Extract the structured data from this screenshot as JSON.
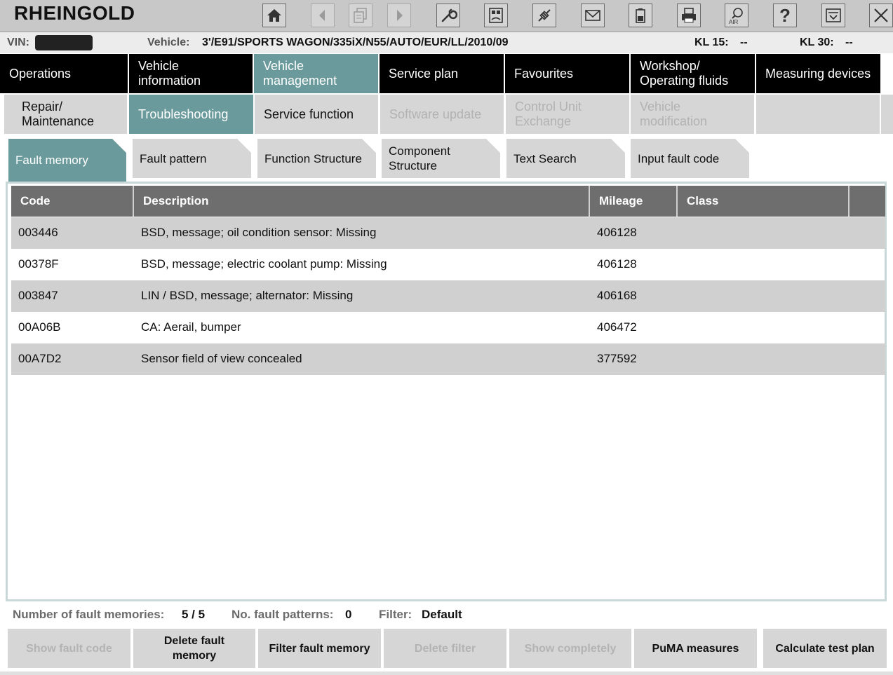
{
  "app": {
    "title": "RHEINGOLD"
  },
  "toolbar": {
    "buttons": [
      {
        "icon": "home-icon",
        "enabled": true
      },
      {
        "icon": "back-arrow-icon",
        "enabled": false
      },
      {
        "icon": "documents-icon",
        "enabled": false
      },
      {
        "icon": "forward-arrow-icon",
        "enabled": false
      },
      {
        "icon": "wrench-icon",
        "enabled": true
      },
      {
        "icon": "calculator-icon",
        "enabled": true
      },
      {
        "icon": "connection-icon",
        "enabled": true
      },
      {
        "icon": "mail-icon",
        "enabled": true
      },
      {
        "icon": "battery-icon",
        "enabled": true
      },
      {
        "icon": "print-icon",
        "enabled": true
      },
      {
        "icon": "air-search-icon",
        "enabled": true,
        "text": "AIR"
      },
      {
        "icon": "help-icon",
        "enabled": true,
        "text": "?"
      },
      {
        "icon": "minimize-icon",
        "enabled": true
      },
      {
        "icon": "close-icon",
        "enabled": true
      }
    ]
  },
  "vehicle_line": {
    "vin_label": "VIN:",
    "vehicle_label": "Vehicle:",
    "vehicle_value": "3'/E91/SPORTS WAGON/335iX/N55/AUTO/EUR/LL/2010/09",
    "kl15_label": "KL 15:",
    "kl15_value": "--",
    "kl30_label": "KL 30:",
    "kl30_value": "--"
  },
  "main_nav": [
    {
      "label": "Operations",
      "active": false
    },
    {
      "label": "Vehicle information",
      "active": false
    },
    {
      "label": "Vehicle management",
      "active": true
    },
    {
      "label": "Service plan",
      "active": false
    },
    {
      "label": "Favourites",
      "active": false
    },
    {
      "label": "Workshop/ Operating fluids",
      "active": false
    },
    {
      "label": "Measuring devices",
      "active": false
    }
  ],
  "sub_nav": [
    {
      "label": "Repair/ Maintenance",
      "state": "normal"
    },
    {
      "label": "Troubleshooting",
      "state": "active"
    },
    {
      "label": "Service function",
      "state": "normal"
    },
    {
      "label": "Software update",
      "state": "disabled"
    },
    {
      "label": "Control Unit Exchange",
      "state": "disabled"
    },
    {
      "label": "Vehicle modification",
      "state": "disabled"
    },
    {
      "label": "",
      "state": "normal"
    }
  ],
  "tabs": [
    {
      "label": "Fault memory",
      "active": true
    },
    {
      "label": "Fault pattern",
      "active": false
    },
    {
      "label": "Function Structure",
      "active": false
    },
    {
      "label": "Component Structure",
      "active": false
    },
    {
      "label": "Text Search",
      "active": false
    },
    {
      "label": "Input fault code",
      "active": false
    }
  ],
  "table": {
    "columns": [
      "Code",
      "Description",
      "Mileage",
      "Class"
    ],
    "rows": [
      {
        "code": "003446",
        "description": "BSD, message; oil condition sensor: Missing",
        "mileage": "406128",
        "class": ""
      },
      {
        "code": "00378F",
        "description": "BSD, message; electric coolant pump: Missing",
        "mileage": "406128",
        "class": ""
      },
      {
        "code": "003847",
        "description": "LIN / BSD, message; alternator: Missing",
        "mileage": "406168",
        "class": ""
      },
      {
        "code": "00A06B",
        "description": "CA: Aerail, bumper",
        "mileage": "406472",
        "class": ""
      },
      {
        "code": "00A7D2",
        "description": "Sensor field of view concealed",
        "mileage": "377592",
        "class": ""
      }
    ]
  },
  "status": {
    "fault_memories_label": "Number of fault memories:",
    "fault_memories_value": "5 / 5",
    "fault_patterns_label": "No. fault patterns:",
    "fault_patterns_value": "0",
    "filter_label": "Filter:",
    "filter_value": "Default"
  },
  "bottom_buttons": [
    {
      "label": "Show fault code",
      "enabled": false
    },
    {
      "label": "Delete fault memory",
      "enabled": true
    },
    {
      "label": "Filter fault memory",
      "enabled": true
    },
    {
      "label": "Delete filter",
      "enabled": false
    },
    {
      "label": "Show completely",
      "enabled": false
    },
    {
      "label": "PuMA measures",
      "enabled": true
    },
    {
      "label": "Calculate test plan",
      "enabled": true
    }
  ],
  "colors": {
    "accent": "#6a9a9b",
    "nav_bg": "#000000",
    "toolbar_bg": "#c8c8c8",
    "header_bg": "#6e6e6e",
    "row_alt": "#d0d0d0"
  }
}
